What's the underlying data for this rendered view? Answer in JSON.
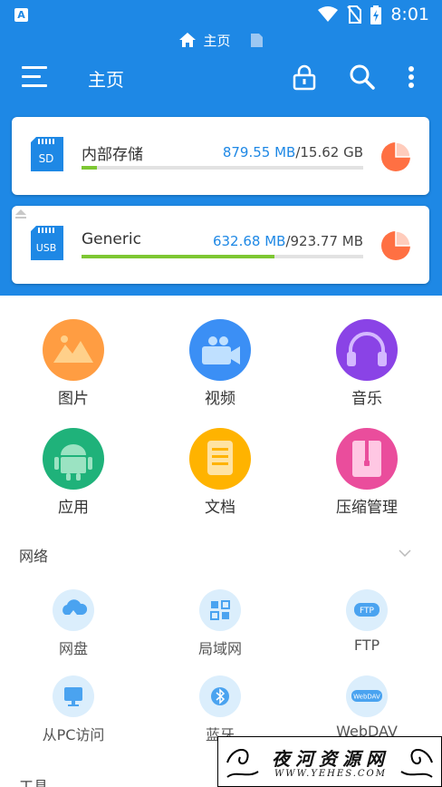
{
  "statusbar": {
    "time": "8:01",
    "app_badge": "A"
  },
  "breadcrumb": {
    "current": "主页"
  },
  "toolbar": {
    "title": "主页"
  },
  "colors": {
    "primary": "#1e88e5",
    "bar_fill": "#7dc733",
    "pie": "#ff7043"
  },
  "storage": [
    {
      "badge": "SD",
      "name": "内部存储",
      "used": "879.55 MB",
      "sep": "/",
      "total": "15.62 GB",
      "fraction": 0.055
    },
    {
      "badge": "USB",
      "name": "Generic",
      "used": "632.68 MB",
      "sep": "/",
      "total": "923.77 MB",
      "fraction": 0.685
    }
  ],
  "categories": [
    {
      "label": "图片",
      "icon": "image-icon"
    },
    {
      "label": "视频",
      "icon": "video-icon"
    },
    {
      "label": "音乐",
      "icon": "music-icon"
    },
    {
      "label": "应用",
      "icon": "android-icon"
    },
    {
      "label": "文档",
      "icon": "document-icon"
    },
    {
      "label": "压缩管理",
      "icon": "archive-icon"
    }
  ],
  "network": {
    "title": "网络",
    "items": [
      {
        "label": "网盘",
        "icon": "cloud-icon"
      },
      {
        "label": "局域网",
        "icon": "lan-icon"
      },
      {
        "label": "FTP",
        "icon": "ftp-icon",
        "badge": "FTP"
      },
      {
        "label": "从PC访问",
        "icon": "monitor-icon"
      },
      {
        "label": "蓝牙",
        "icon": "bluetooth-icon"
      },
      {
        "label": "WebDAV",
        "icon": "webdav-icon",
        "badge": "WebDAV"
      }
    ]
  },
  "tools": {
    "title": "工具"
  },
  "watermark": {
    "title": "夜河资源网",
    "url": "WWW.YEHES.COM"
  }
}
